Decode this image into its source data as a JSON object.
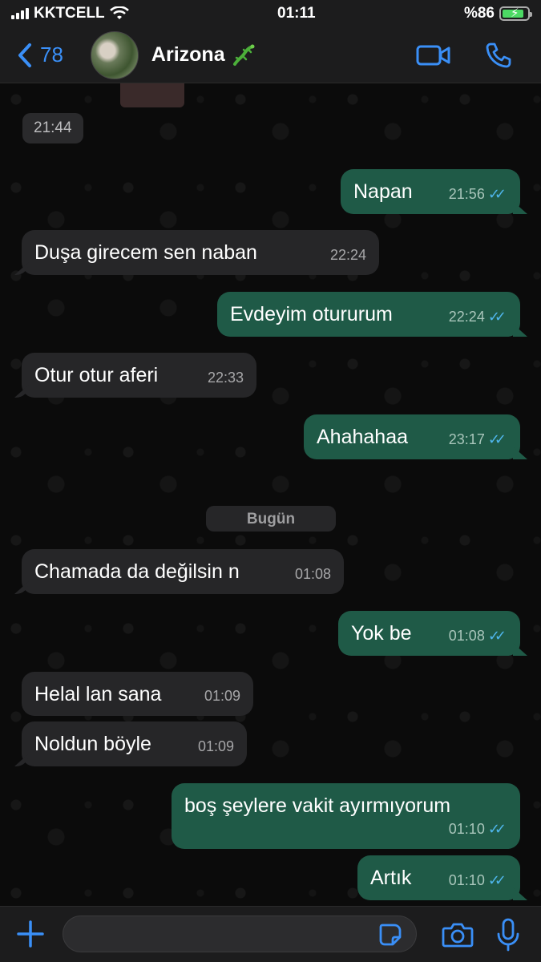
{
  "status_bar": {
    "carrier": "KKTCELL",
    "time": "01:11",
    "battery": "%86",
    "battery_level": 0.86
  },
  "header": {
    "back_count": "78",
    "contact_name": "Arizona",
    "contact_emoji_icon": "lizard-icon",
    "actions": [
      "video-call-icon",
      "phone-icon"
    ]
  },
  "chat": {
    "top_time": "21:44",
    "date_divider": "Bugün",
    "messages": [
      {
        "dir": "out",
        "text": "Napan",
        "time": "21:56",
        "read": true
      },
      {
        "dir": "in",
        "text": "Duşa girecem sen naban",
        "time": "22:24"
      },
      {
        "dir": "out",
        "text": "Evdeyim otururum",
        "time": "22:24",
        "read": true
      },
      {
        "dir": "in",
        "text": "Otur otur aferi",
        "time": "22:33"
      },
      {
        "dir": "out",
        "text": "Ahahahaa",
        "time": "23:17",
        "read": true
      },
      {
        "dir": "in",
        "text": "Chamada da değilsin n",
        "time": "01:08"
      },
      {
        "dir": "out",
        "text": "Yok be",
        "time": "01:08",
        "read": true
      },
      {
        "dir": "in",
        "text": "Helal lan sana",
        "time": "01:09"
      },
      {
        "dir": "in",
        "text": "Noldun böyle",
        "time": "01:09"
      },
      {
        "dir": "out",
        "text": "boş şeylere vakit ayırmıyorum",
        "time": "01:10",
        "read": true
      },
      {
        "dir": "out",
        "text": "Artık",
        "time": "01:10",
        "read": true
      }
    ]
  },
  "composer": {
    "placeholder": "",
    "icons": [
      "plus-icon",
      "sticker-icon",
      "camera-icon",
      "microphone-icon"
    ]
  },
  "colors": {
    "accent": "#3a8ff7",
    "incoming_bubble": "#262628",
    "outgoing_bubble": "#1f5a47",
    "read_ticks": "#4fb6ec"
  }
}
